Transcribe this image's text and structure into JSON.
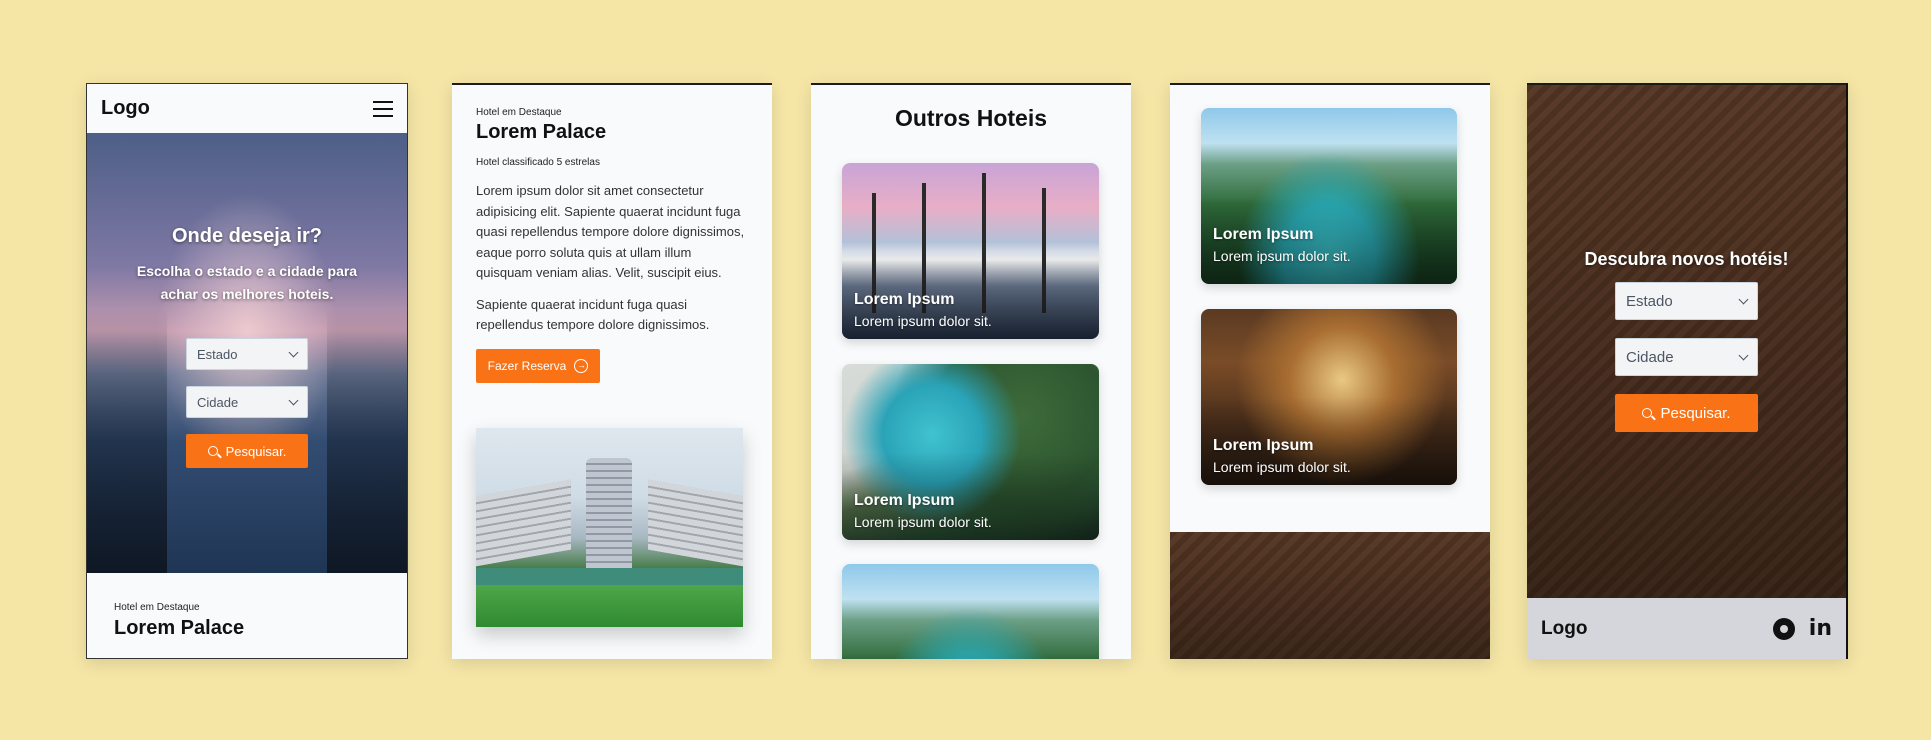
{
  "panel1": {
    "logo": "Logo",
    "hero_title": "Onde deseja ir?",
    "hero_subtitle": "Escolha o estado e a cidade para achar os melhores hoteis.",
    "state_select": "Estado",
    "city_select": "Cidade",
    "search_button": "Pesquisar.",
    "featured_label": "Hotel em Destaque",
    "featured_name": "Lorem Palace"
  },
  "panel2": {
    "featured_label": "Hotel em Destaque",
    "title": "Lorem Palace",
    "rating": "Hotel classificado 5 estrelas",
    "paragraph1": "Lorem ipsum dolor sit amet consectetur adipisicing elit. Sapiente quaerat incidunt fuga quasi repellendus tempore dolore dignissimos, eaque porro soluta quis at ullam illum quisquam veniam alias. Velit, suscipit eius.",
    "paragraph2": "Sapiente quaerat incidunt fuga quasi repellendus tempore dolore dignissimos.",
    "reserve_button": "Fazer Reserva"
  },
  "panel3": {
    "heading": "Outros Hoteis",
    "cards": [
      {
        "title": "Lorem Ipsum",
        "subtitle": "Lorem ipsum dolor sit."
      },
      {
        "title": "Lorem Ipsum",
        "subtitle": "Lorem ipsum dolor sit."
      }
    ]
  },
  "panel4": {
    "cards": [
      {
        "title": "Lorem Ipsum",
        "subtitle": "Lorem ipsum dolor sit."
      },
      {
        "title": "Lorem Ipsum",
        "subtitle": "Lorem ipsum dolor sit."
      }
    ]
  },
  "panel5": {
    "hero_title": "Descubra novos hotéis!",
    "state_select": "Estado",
    "city_select": "Cidade",
    "search_button": "Pesquisar.",
    "footer_logo": "Logo",
    "linkedin_glyph": "in"
  },
  "colors": {
    "page_background": "#f5e6a6",
    "accent": "#f97316",
    "footer_background": "#d4d6dc"
  }
}
